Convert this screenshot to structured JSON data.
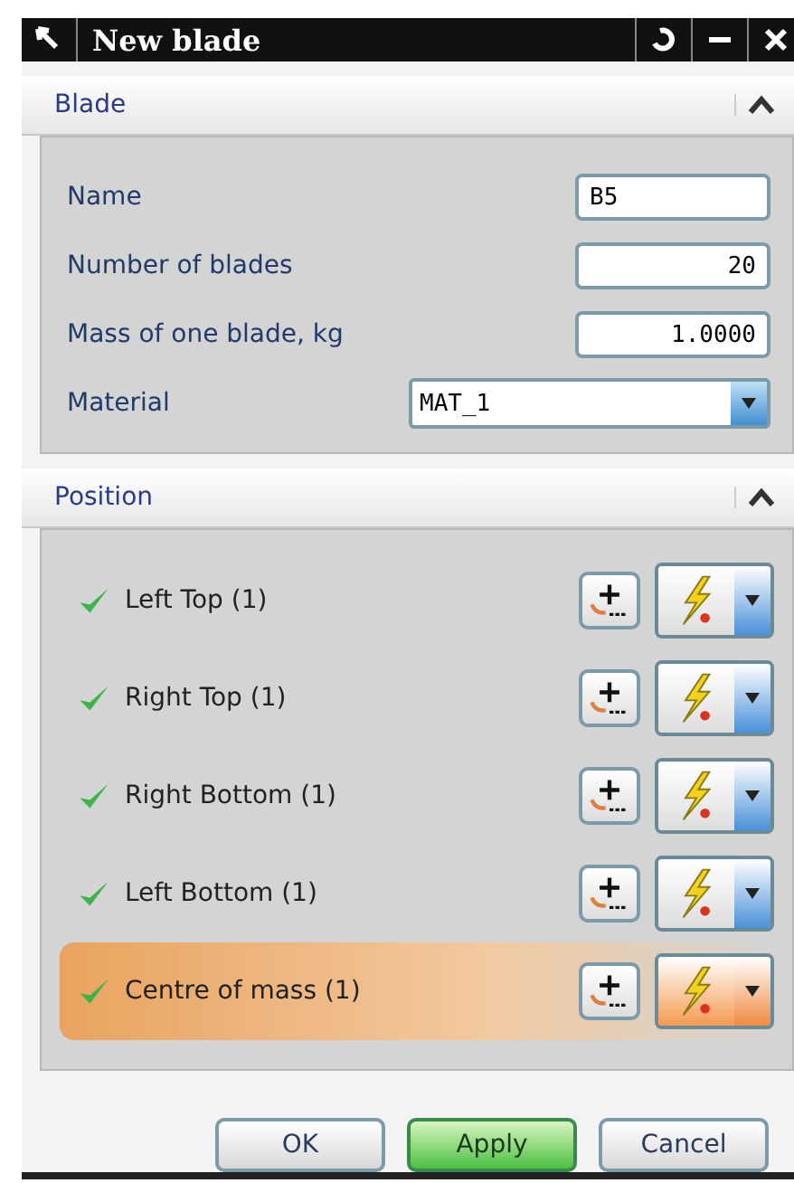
{
  "window": {
    "title": "New blade"
  },
  "blade": {
    "title": "Blade",
    "fields": [
      {
        "label": "Name",
        "value": "B5",
        "kind": "text"
      },
      {
        "label": "Number of blades",
        "value": "20",
        "kind": "number"
      },
      {
        "label": "Mass of one blade, kg",
        "value": "1.0000",
        "kind": "number"
      },
      {
        "label": "Material",
        "value": "MAT_1",
        "kind": "dropdown"
      }
    ]
  },
  "position": {
    "title": "Position",
    "items": [
      {
        "label": "Left Top (1)",
        "selected": false
      },
      {
        "label": "Right Top (1)",
        "selected": false
      },
      {
        "label": "Right Bottom (1)",
        "selected": false
      },
      {
        "label": "Left Bottom (1)",
        "selected": false
      },
      {
        "label": "Centre of mass (1)",
        "selected": true
      }
    ]
  },
  "buttons": [
    {
      "label": "OK",
      "default": false
    },
    {
      "label": "Apply",
      "default": true
    },
    {
      "label": "Cancel",
      "default": false
    }
  ]
}
